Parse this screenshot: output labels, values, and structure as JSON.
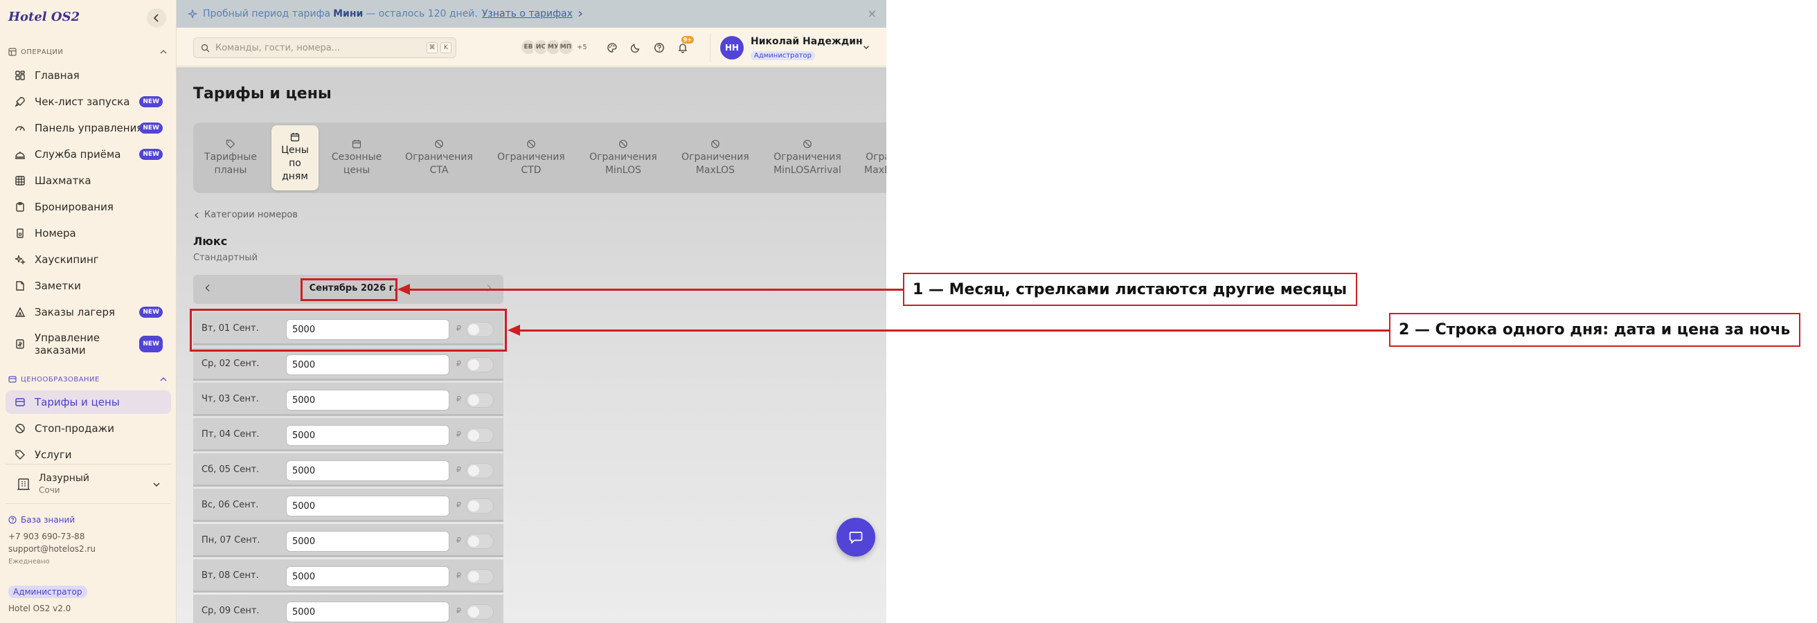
{
  "app": {
    "brand": "Hotel OS2"
  },
  "sidebar": {
    "sections": [
      {
        "title": "ОПЕРАЦИИ"
      },
      {
        "title": "ЦЕНООБРАЗОВАНИЕ"
      }
    ],
    "operations": [
      {
        "label": "Главная",
        "badge": ""
      },
      {
        "label": "Чек-лист запуска",
        "badge": "NEW"
      },
      {
        "label": "Панель управления",
        "badge": "NEW"
      },
      {
        "label": "Служба приёма",
        "badge": "NEW"
      },
      {
        "label": "Шахматка",
        "badge": ""
      },
      {
        "label": "Бронирования",
        "badge": ""
      },
      {
        "label": "Номера",
        "badge": ""
      },
      {
        "label": "Хаускипинг",
        "badge": ""
      },
      {
        "label": "Заметки",
        "badge": ""
      },
      {
        "label": "Заказы лагеря",
        "badge": "NEW"
      },
      {
        "label": "Управление заказами",
        "badge": "NEW"
      }
    ],
    "pricing": [
      {
        "label": "Тарифы и цены"
      },
      {
        "label": "Стоп-продажи"
      },
      {
        "label": "Услуги"
      }
    ],
    "property": {
      "name": "Лазурный",
      "city": "Сочи"
    },
    "knowledge_base": "База знаний",
    "phone": "+7 903 690-73-88",
    "email": "support@hotelos2.ru",
    "schedule": "Ежедневно",
    "role_badge": "Администратор",
    "version": "Hotel OS2 v2.0"
  },
  "banner": {
    "prefix": "Пробный период тарифа",
    "plan": "Мини",
    "suffix": "— осталось 120 дней.",
    "link": "Узнать о тарифах",
    "close": "×"
  },
  "topbar": {
    "search_placeholder": "Команды, гости, номера...",
    "kbd": [
      "⌘",
      "K"
    ],
    "presence": [
      "ЕВ",
      "ИС",
      "МУ",
      "МП"
    ],
    "presence_more": "+5",
    "notifications": "9+",
    "user": {
      "initials": "НН",
      "name": "Николай Надеждин",
      "role": "Администратор"
    }
  },
  "main": {
    "title": "Тарифы и цены",
    "tabs": [
      {
        "label": "Тарифные планы",
        "icon": "tag-icon"
      },
      {
        "label": "Цены по дням",
        "icon": "calendar-icon"
      },
      {
        "label": "Сезонные цены",
        "icon": "calendar-icon"
      },
      {
        "label": "Ограничения CTA",
        "icon": "ban-icon"
      },
      {
        "label": "Ограничения CTD",
        "icon": "ban-icon"
      },
      {
        "label": "Ограничения MinLOS",
        "icon": "ban-icon"
      },
      {
        "label": "Ограничения MaxLOS",
        "icon": "ban-icon"
      },
      {
        "label": "Ограничения MinLOSArrival",
        "icon": "ban-icon"
      },
      {
        "label": "Ограничения MaxLOSArrival",
        "icon": "ban-icon"
      }
    ],
    "back_link": "Категории номеров",
    "room_title": "Люкс",
    "room_subtitle": "Стандартный",
    "month": "Сентябрь 2026 г.",
    "currency": "₽",
    "days": [
      {
        "label": "Вт, 01 Сент.",
        "price": "5000"
      },
      {
        "label": "Ср, 02 Сент.",
        "price": "5000"
      },
      {
        "label": "Чт, 03 Сент.",
        "price": "5000"
      },
      {
        "label": "Пт, 04 Сент.",
        "price": "5000"
      },
      {
        "label": "Сб, 05 Сент.",
        "price": "5000"
      },
      {
        "label": "Вс, 06 Сент.",
        "price": "5000"
      },
      {
        "label": "Пн, 07 Сент.",
        "price": "5000"
      },
      {
        "label": "Вт, 08 Сент.",
        "price": "5000"
      },
      {
        "label": "Ср, 09 Сент.",
        "price": "5000"
      }
    ]
  },
  "annotations": [
    {
      "text": "1 — Месяц, стрелками листаются другие месяцы"
    },
    {
      "text": "2 — Строка одного дня: дата и цена за ночь"
    }
  ],
  "colors": {
    "accent": "#5244d6",
    "annotation": "#cc1f24",
    "banner_bg": "#c6cdd1"
  }
}
